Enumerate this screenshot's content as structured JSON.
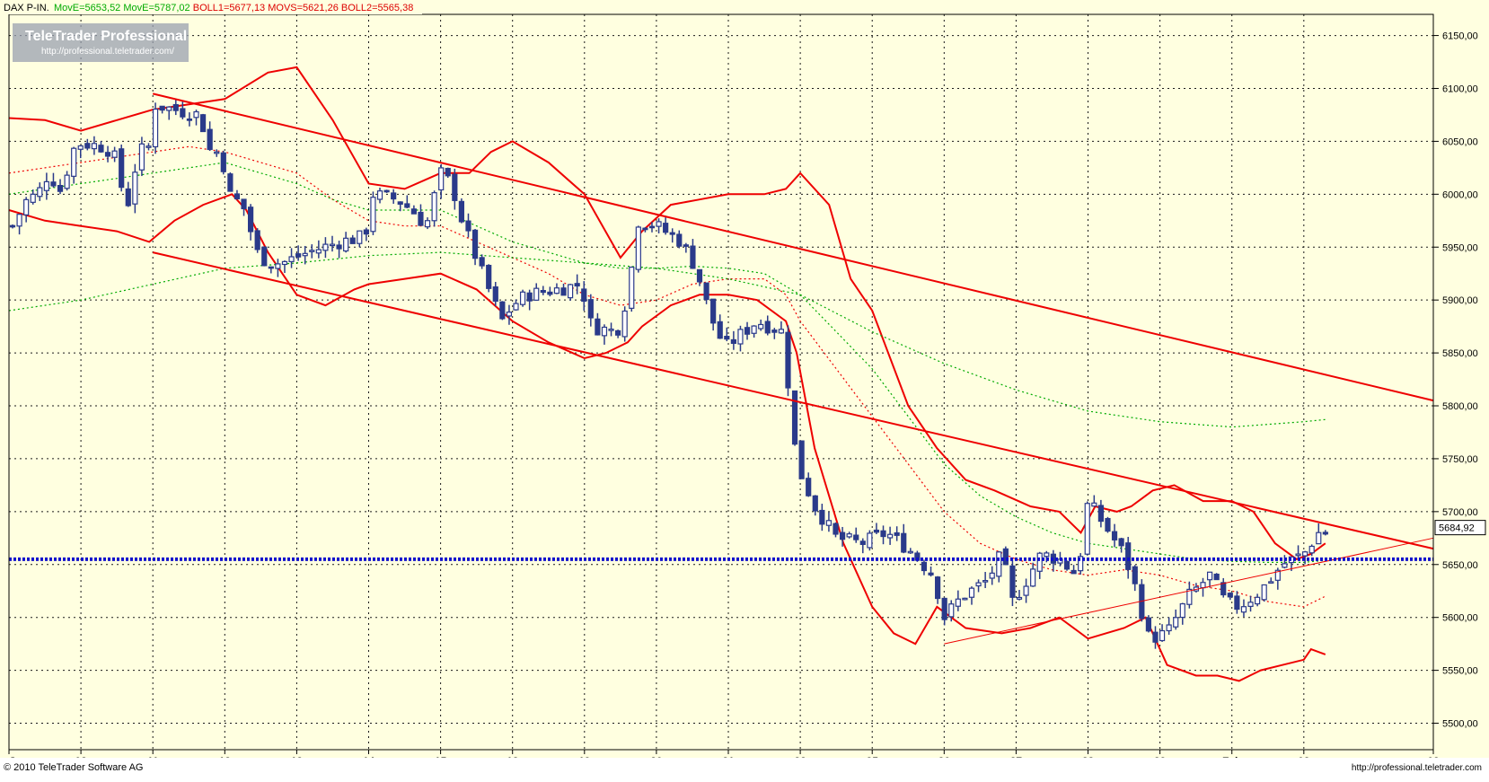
{
  "header": {
    "symbol": "DAX P-IN.",
    "indicators": [
      {
        "text": "MovE=5653,52",
        "color": "#00aa00"
      },
      {
        "text": "MovE=5787,02",
        "color": "#00aa00"
      },
      {
        "text": "BOLL1=5677,13",
        "color": "#dd0000"
      },
      {
        "text": "MOVS=5621,26",
        "color": "#dd0000"
      },
      {
        "text": "BOLL2=5565,38",
        "color": "#dd0000"
      }
    ]
  },
  "watermark": {
    "title": "TeleTrader Professional",
    "url": "http://professional.teletrader.com/"
  },
  "footer": {
    "copyright": "© 2010 TeleTrader Software AG",
    "link": "http://professional.teletrader.com"
  },
  "last_price_label": "5684,92",
  "colors": {
    "background": "#ffffe0",
    "grid": "#1a1a1a",
    "candle": "#2a3a8a",
    "bollinger": "#ee0000",
    "sma": "#ee0000",
    "ema_fast": "#00aa00",
    "ema_slow": "#00aa00",
    "support": "#1010cc"
  },
  "chart_data": {
    "type": "candlestick",
    "y_range": [
      5475,
      6170
    ],
    "y_ticks": [
      5500,
      5550,
      5600,
      5650,
      5700,
      5750,
      5800,
      5850,
      5900,
      5950,
      6000,
      6050,
      6100,
      6150
    ],
    "y_tick_labels": [
      "5500,00",
      "5550,00",
      "5600,00",
      "5650,00",
      "5700,00",
      "5750,00",
      "5800,00",
      "5850,00",
      "5900,00",
      "5950,00",
      "6000,00",
      "6050,00",
      "6100,00",
      "6150,00"
    ],
    "x_range": [
      0,
      19.8
    ],
    "x_ticks": [
      {
        "x": 0,
        "label": "Jan"
      },
      {
        "x": 1,
        "label": "08"
      },
      {
        "x": 2,
        "label": "11"
      },
      {
        "x": 3,
        "label": "12"
      },
      {
        "x": 4,
        "label": "13"
      },
      {
        "x": 5,
        "label": "14"
      },
      {
        "x": 6,
        "label": "15"
      },
      {
        "x": 7,
        "label": "18"
      },
      {
        "x": 8,
        "label": "19"
      },
      {
        "x": 9,
        "label": "20"
      },
      {
        "x": 10,
        "label": "21"
      },
      {
        "x": 11,
        "label": "22"
      },
      {
        "x": 12,
        "label": "25"
      },
      {
        "x": 13,
        "label": "26"
      },
      {
        "x": 14,
        "label": "27"
      },
      {
        "x": 15,
        "label": "28"
      },
      {
        "x": 16,
        "label": "29"
      },
      {
        "x": 17,
        "label": "Feb"
      },
      {
        "x": 18,
        "label": "02"
      },
      {
        "x": 19.8,
        "label": "03"
      }
    ],
    "grid": true,
    "candle_anchors": [
      {
        "x": 0.05,
        "p": 5970
      },
      {
        "x": 0.25,
        "p": 5995
      },
      {
        "x": 0.4,
        "p": 6000
      },
      {
        "x": 0.55,
        "p": 6020
      },
      {
        "x": 0.75,
        "p": 6000
      },
      {
        "x": 0.85,
        "p": 6040
      },
      {
        "x": 1.0,
        "p": 6048
      },
      {
        "x": 1.25,
        "p": 6046
      },
      {
        "x": 1.45,
        "p": 6040
      },
      {
        "x": 1.55,
        "p": 6010
      },
      {
        "x": 1.65,
        "p": 5990
      },
      {
        "x": 1.8,
        "p": 6040
      },
      {
        "x": 1.95,
        "p": 6045
      },
      {
        "x": 2.0,
        "p": 6085
      },
      {
        "x": 2.3,
        "p": 6080
      },
      {
        "x": 2.65,
        "p": 6075
      },
      {
        "x": 2.8,
        "p": 6040
      },
      {
        "x": 2.95,
        "p": 6040
      },
      {
        "x": 3.05,
        "p": 6000
      },
      {
        "x": 3.25,
        "p": 5990
      },
      {
        "x": 3.45,
        "p": 5945
      },
      {
        "x": 3.6,
        "p": 5935
      },
      {
        "x": 3.8,
        "p": 5935
      },
      {
        "x": 4.15,
        "p": 5945
      },
      {
        "x": 4.6,
        "p": 5955
      },
      {
        "x": 4.95,
        "p": 5960
      },
      {
        "x": 5.05,
        "p": 6000
      },
      {
        "x": 5.4,
        "p": 5995
      },
      {
        "x": 5.6,
        "p": 5985
      },
      {
        "x": 5.8,
        "p": 5970
      },
      {
        "x": 6.0,
        "p": 6020
      },
      {
        "x": 6.15,
        "p": 6010
      },
      {
        "x": 6.3,
        "p": 5975
      },
      {
        "x": 6.55,
        "p": 5930
      },
      {
        "x": 6.85,
        "p": 5880
      },
      {
        "x": 7.0,
        "p": 5895
      },
      {
        "x": 7.2,
        "p": 5905
      },
      {
        "x": 7.6,
        "p": 5910
      },
      {
        "x": 7.95,
        "p": 5915
      },
      {
        "x": 8.1,
        "p": 5875
      },
      {
        "x": 8.45,
        "p": 5870
      },
      {
        "x": 8.6,
        "p": 5905
      },
      {
        "x": 8.75,
        "p": 5975
      },
      {
        "x": 9.0,
        "p": 5970
      },
      {
        "x": 9.35,
        "p": 5955
      },
      {
        "x": 9.55,
        "p": 5930
      },
      {
        "x": 9.75,
        "p": 5885
      },
      {
        "x": 9.95,
        "p": 5855
      },
      {
        "x": 10.4,
        "p": 5880
      },
      {
        "x": 10.75,
        "p": 5870
      },
      {
        "x": 10.85,
        "p": 5810
      },
      {
        "x": 10.95,
        "p": 5745
      },
      {
        "x": 11.2,
        "p": 5705
      },
      {
        "x": 11.5,
        "p": 5675
      },
      {
        "x": 11.85,
        "p": 5670
      },
      {
        "x": 12.2,
        "p": 5680
      },
      {
        "x": 12.5,
        "p": 5665
      },
      {
        "x": 12.85,
        "p": 5640
      },
      {
        "x": 13.0,
        "p": 5600
      },
      {
        "x": 13.25,
        "p": 5620
      },
      {
        "x": 13.6,
        "p": 5635
      },
      {
        "x": 13.8,
        "p": 5660
      },
      {
        "x": 13.95,
        "p": 5615
      },
      {
        "x": 14.1,
        "p": 5630
      },
      {
        "x": 14.35,
        "p": 5660
      },
      {
        "x": 14.6,
        "p": 5655
      },
      {
        "x": 14.85,
        "p": 5640
      },
      {
        "x": 15.0,
        "p": 5710
      },
      {
        "x": 15.2,
        "p": 5690
      },
      {
        "x": 15.5,
        "p": 5660
      },
      {
        "x": 15.65,
        "p": 5630
      },
      {
        "x": 15.85,
        "p": 5580
      },
      {
        "x": 16.1,
        "p": 5585
      },
      {
        "x": 16.4,
        "p": 5620
      },
      {
        "x": 16.7,
        "p": 5640
      },
      {
        "x": 16.9,
        "p": 5615
      },
      {
        "x": 17.1,
        "p": 5610
      },
      {
        "x": 17.4,
        "p": 5625
      },
      {
        "x": 17.7,
        "p": 5650
      },
      {
        "x": 18.0,
        "p": 5660
      },
      {
        "x": 18.2,
        "p": 5680
      }
    ],
    "series": [
      {
        "kind": "bollinger_upper",
        "points": [
          [
            0,
            6072
          ],
          [
            0.5,
            6070
          ],
          [
            1.0,
            6060
          ],
          [
            1.5,
            6070
          ],
          [
            2.0,
            6080
          ],
          [
            2.5,
            6085
          ],
          [
            3.0,
            6090
          ],
          [
            3.6,
            6115
          ],
          [
            4.0,
            6120
          ],
          [
            4.5,
            6070
          ],
          [
            5.0,
            6010
          ],
          [
            5.5,
            6005
          ],
          [
            6.0,
            6020
          ],
          [
            6.4,
            6020
          ],
          [
            6.7,
            6040
          ],
          [
            7.0,
            6050
          ],
          [
            7.5,
            6030
          ],
          [
            8.0,
            6000
          ],
          [
            8.5,
            5940
          ],
          [
            8.8,
            5965
          ],
          [
            9.2,
            5990
          ],
          [
            9.6,
            5995
          ],
          [
            10.0,
            6000
          ],
          [
            10.5,
            6000
          ],
          [
            10.8,
            6005
          ],
          [
            11.0,
            6020
          ],
          [
            11.4,
            5990
          ],
          [
            11.7,
            5920
          ],
          [
            12.0,
            5890
          ],
          [
            12.5,
            5800
          ],
          [
            12.9,
            5760
          ],
          [
            13.3,
            5730
          ],
          [
            13.7,
            5720
          ],
          [
            14.2,
            5705
          ],
          [
            14.6,
            5700
          ],
          [
            14.9,
            5680
          ],
          [
            15.1,
            5705
          ],
          [
            15.4,
            5700
          ],
          [
            15.6,
            5705
          ],
          [
            15.9,
            5720
          ],
          [
            16.2,
            5725
          ],
          [
            16.6,
            5710
          ],
          [
            17.0,
            5710
          ],
          [
            17.3,
            5700
          ],
          [
            17.6,
            5670
          ],
          [
            17.9,
            5655
          ],
          [
            18.1,
            5660
          ],
          [
            18.3,
            5670
          ]
        ]
      },
      {
        "kind": "sma",
        "points": [
          [
            0,
            6020
          ],
          [
            0.5,
            6025
          ],
          [
            1.0,
            6030
          ],
          [
            1.5,
            6035
          ],
          [
            2.0,
            6040
          ],
          [
            2.5,
            6045
          ],
          [
            3.0,
            6040
          ],
          [
            3.5,
            6030
          ],
          [
            4.0,
            6020
          ],
          [
            4.5,
            5995
          ],
          [
            5.0,
            5975
          ],
          [
            5.5,
            5970
          ],
          [
            6.0,
            5970
          ],
          [
            6.5,
            5955
          ],
          [
            7.0,
            5940
          ],
          [
            7.5,
            5925
          ],
          [
            8.0,
            5905
          ],
          [
            8.5,
            5895
          ],
          [
            9.0,
            5900
          ],
          [
            9.5,
            5915
          ],
          [
            10.0,
            5920
          ],
          [
            10.5,
            5920
          ],
          [
            10.8,
            5905
          ],
          [
            11.0,
            5880
          ],
          [
            11.5,
            5835
          ],
          [
            12.0,
            5790
          ],
          [
            12.5,
            5745
          ],
          [
            13.0,
            5700
          ],
          [
            13.5,
            5670
          ],
          [
            14.0,
            5655
          ],
          [
            14.5,
            5645
          ],
          [
            15.0,
            5640
          ],
          [
            15.5,
            5645
          ],
          [
            16.0,
            5640
          ],
          [
            16.5,
            5630
          ],
          [
            17.0,
            5625
          ],
          [
            17.5,
            5615
          ],
          [
            18.0,
            5610
          ],
          [
            18.3,
            5620
          ]
        ]
      },
      {
        "kind": "bollinger_lower",
        "points": [
          [
            0,
            5985
          ],
          [
            0.5,
            5975
          ],
          [
            1.0,
            5970
          ],
          [
            1.5,
            5965
          ],
          [
            1.95,
            5955
          ],
          [
            2.3,
            5975
          ],
          [
            2.7,
            5990
          ],
          [
            3.1,
            6000
          ],
          [
            3.3,
            5985
          ],
          [
            3.6,
            5945
          ],
          [
            4.0,
            5905
          ],
          [
            4.4,
            5895
          ],
          [
            4.8,
            5910
          ],
          [
            5.0,
            5915
          ],
          [
            5.5,
            5920
          ],
          [
            6.0,
            5925
          ],
          [
            6.5,
            5910
          ],
          [
            7.0,
            5880
          ],
          [
            7.5,
            5860
          ],
          [
            8.0,
            5845
          ],
          [
            8.3,
            5850
          ],
          [
            8.6,
            5860
          ],
          [
            8.8,
            5875
          ],
          [
            9.2,
            5895
          ],
          [
            9.6,
            5905
          ],
          [
            10.0,
            5905
          ],
          [
            10.4,
            5900
          ],
          [
            10.8,
            5880
          ],
          [
            10.95,
            5850
          ],
          [
            11.2,
            5760
          ],
          [
            11.6,
            5670
          ],
          [
            12.0,
            5610
          ],
          [
            12.3,
            5585
          ],
          [
            12.6,
            5575
          ],
          [
            12.9,
            5610
          ],
          [
            13.3,
            5590
          ],
          [
            13.8,
            5585
          ],
          [
            14.2,
            5590
          ],
          [
            14.6,
            5600
          ],
          [
            15.0,
            5580
          ],
          [
            15.5,
            5590
          ],
          [
            15.8,
            5600
          ],
          [
            16.1,
            5555
          ],
          [
            16.5,
            5545
          ],
          [
            16.8,
            5545
          ],
          [
            17.1,
            5540
          ],
          [
            17.4,
            5550
          ],
          [
            17.7,
            5555
          ],
          [
            18.0,
            5560
          ],
          [
            18.1,
            5570
          ],
          [
            18.3,
            5565
          ]
        ]
      },
      {
        "kind": "ema_fast",
        "points": [
          [
            0,
            6000
          ],
          [
            0.5,
            6005
          ],
          [
            1.0,
            6010
          ],
          [
            1.5,
            6015
          ],
          [
            2.0,
            6020
          ],
          [
            2.5,
            6025
          ],
          [
            3.0,
            6030
          ],
          [
            3.5,
            6020
          ],
          [
            4.0,
            6010
          ],
          [
            4.5,
            5995
          ],
          [
            5.0,
            5985
          ],
          [
            5.5,
            5985
          ],
          [
            6.0,
            5985
          ],
          [
            6.5,
            5970
          ],
          [
            7.0,
            5955
          ],
          [
            7.5,
            5945
          ],
          [
            8.0,
            5935
          ],
          [
            8.5,
            5930
          ],
          [
            9.0,
            5930
          ],
          [
            9.5,
            5932
          ],
          [
            10.0,
            5930
          ],
          [
            10.5,
            5925
          ],
          [
            11.0,
            5905
          ],
          [
            11.5,
            5870
          ],
          [
            12.0,
            5835
          ],
          [
            12.5,
            5790
          ],
          [
            13.0,
            5745
          ],
          [
            13.5,
            5715
          ],
          [
            14.0,
            5695
          ],
          [
            14.5,
            5680
          ],
          [
            15.0,
            5670
          ],
          [
            15.5,
            5665
          ],
          [
            16.0,
            5660
          ],
          [
            16.5,
            5655
          ],
          [
            17.0,
            5653
          ],
          [
            17.5,
            5652
          ],
          [
            18.0,
            5652
          ],
          [
            18.3,
            5654
          ]
        ]
      },
      {
        "kind": "ema_slow",
        "points": [
          [
            0,
            5890
          ],
          [
            1.0,
            5900
          ],
          [
            2.0,
            5915
          ],
          [
            3.0,
            5930
          ],
          [
            4.0,
            5935
          ],
          [
            5.0,
            5942
          ],
          [
            6.0,
            5945
          ],
          [
            7.0,
            5940
          ],
          [
            8.0,
            5935
          ],
          [
            9.0,
            5930
          ],
          [
            10.0,
            5920
          ],
          [
            11.0,
            5905
          ],
          [
            12.0,
            5870
          ],
          [
            13.0,
            5840
          ],
          [
            14.0,
            5815
          ],
          [
            15.0,
            5795
          ],
          [
            16.0,
            5785
          ],
          [
            17.0,
            5780
          ],
          [
            18.0,
            5785
          ],
          [
            18.3,
            5787
          ]
        ]
      }
    ],
    "trendlines": [
      {
        "kind": "channel_upper",
        "from": [
          2.0,
          6095
        ],
        "to": [
          19.8,
          5805
        ],
        "width": 2
      },
      {
        "kind": "channel_lower",
        "from": [
          2.0,
          5945
        ],
        "to": [
          19.8,
          5665
        ],
        "width": 2
      },
      {
        "kind": "rising_support",
        "from": [
          13.0,
          5575
        ],
        "to": [
          19.8,
          5675
        ],
        "width": 1
      }
    ],
    "support_level": 5655,
    "last_price": 5684.92
  }
}
